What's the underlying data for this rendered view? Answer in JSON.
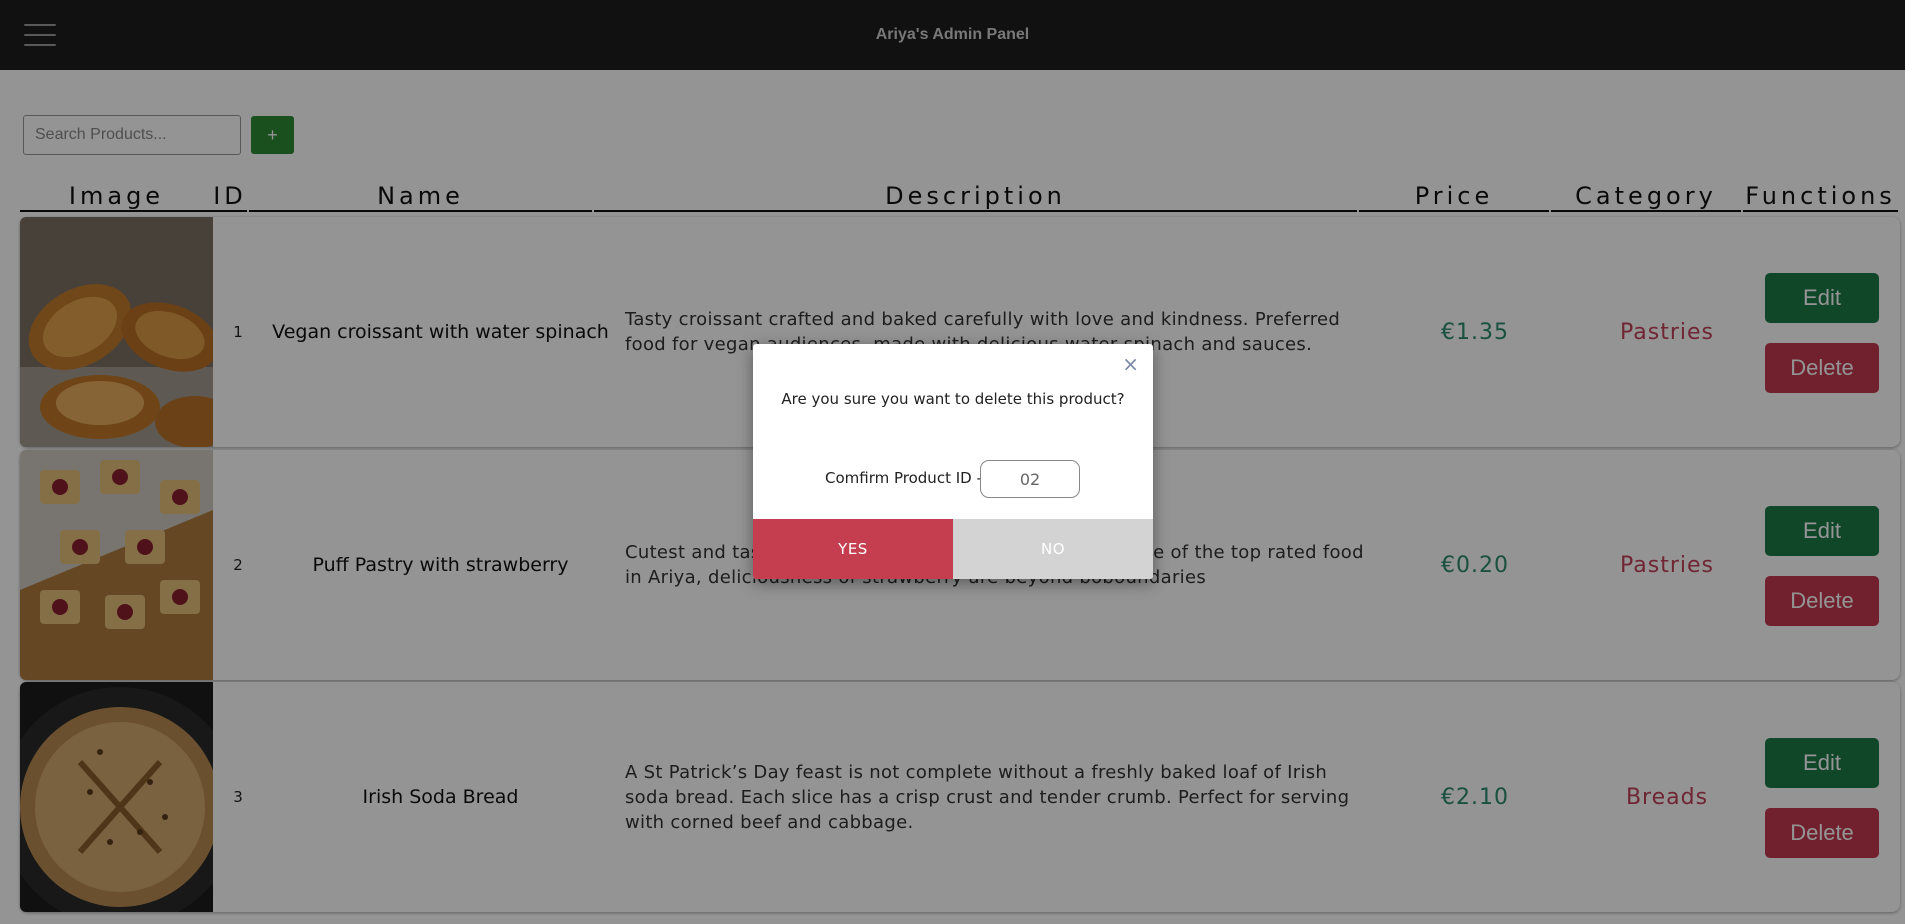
{
  "header": {
    "title": "Ariya's Admin Panel",
    "menu_icon": "hamburger-menu-icon"
  },
  "toolbar": {
    "search_placeholder": "Search Products...",
    "add_label": "+"
  },
  "table": {
    "columns": [
      "Image",
      "ID",
      "Name",
      "Description",
      "Price",
      "Category",
      "Functions"
    ],
    "rows": [
      {
        "image": "croissant-photo",
        "id": "1",
        "name": "Vegan croissant with water spinach",
        "description": "Tasty croissant crafted and baked carefully with love and kindness. Preferred food for vegan audiences, made with delicious water spinach and sauces.",
        "price": "€1.35",
        "category": "Pastries",
        "edit_label": "Edit",
        "delete_label": "Delete"
      },
      {
        "image": "puff-pastry-photo",
        "id": "2",
        "name": "Puff Pastry with strawberry",
        "description": "Cutest and tastiest puff pastry with strawberry filling, one of the top rated food in Ariya, deliciousness of strawberry are beyond boboundaries",
        "price": "€0.20",
        "category": "Pastries",
        "edit_label": "Edit",
        "delete_label": "Delete"
      },
      {
        "image": "soda-bread-photo",
        "id": "3",
        "name": "Irish Soda Bread",
        "description": "A St Patrick’s Day feast is not complete without a freshly baked loaf of Irish soda bread. Each slice has a crisp crust and tender crumb. Perfect for serving with corned beef and cabbage.",
        "price": "€2.10",
        "category": "Breads",
        "edit_label": "Edit",
        "delete_label": "Delete"
      }
    ]
  },
  "modal": {
    "close_label": "×",
    "message": "Are you sure you want to delete this product?",
    "confirm_label": "Comfirm Product ID -",
    "confirm_value": "02",
    "yes_label": "YES",
    "no_label": "NO"
  },
  "colors": {
    "topbar": "#1e1e1e",
    "add_button": "#2e8b34",
    "edit_button": "#1c7a47",
    "delete_button": "#c2394e",
    "price": "#2b8a6e",
    "category": "#c2415a",
    "yes_button": "#c53e4f",
    "no_button": "#d3d3d3"
  }
}
